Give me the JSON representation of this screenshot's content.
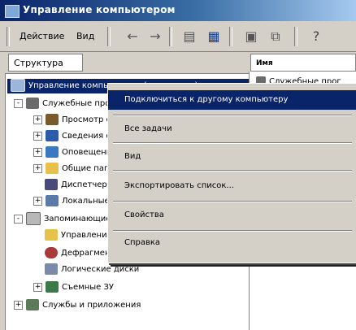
{
  "window": {
    "title": "Управление компьютером"
  },
  "toolbar": {
    "action_label": "Действие",
    "view_label": "Вид",
    "icons": [
      "back-icon",
      "forward-icon",
      "up-icon",
      "console-icon",
      "properties-icon",
      "export-icon",
      "help-icon"
    ]
  },
  "left_panel": {
    "header": "Структура"
  },
  "right_panel": {
    "header": "Имя",
    "first_item": "Служебные прог"
  },
  "tree": {
    "root": "Управление компьютером (локальным)",
    "items": [
      {
        "label": "Служебные программы",
        "level": 1,
        "expand": "-"
      },
      {
        "label": "Просмотр событий",
        "level": 2,
        "expand": "+"
      },
      {
        "label": "Сведения о системе",
        "level": 2,
        "expand": "+"
      },
      {
        "label": "Оповещения и журналы",
        "level": 2,
        "expand": "+"
      },
      {
        "label": "Общие папки",
        "level": 2,
        "expand": "+"
      },
      {
        "label": "Диспетчер устройств",
        "level": 2,
        "expand": ""
      },
      {
        "label": "Локальные пользователи",
        "level": 2,
        "expand": "+"
      },
      {
        "label": "Запоминающие устройства",
        "level": 1,
        "expand": "-"
      },
      {
        "label": "Управление дисками",
        "level": 2,
        "expand": ""
      },
      {
        "label": "Дефрагментация диска",
        "level": 2,
        "expand": ""
      },
      {
        "label": "Логические диски",
        "level": 2,
        "expand": ""
      },
      {
        "label": "Съемные ЗУ",
        "level": 2,
        "expand": "+"
      },
      {
        "label": "Службы и приложения",
        "level": 1,
        "expand": "+"
      }
    ]
  },
  "context_menu": {
    "items": [
      {
        "label": "Подключиться к другому компьютеру",
        "highlighted": true
      },
      {
        "label": "Все задачи"
      },
      {
        "label": "Вид"
      },
      {
        "label": "Экспортировать список..."
      },
      {
        "label": "Свойства"
      },
      {
        "label": "Справка"
      }
    ]
  },
  "colors": {
    "selection": "#0a246a",
    "face": "#d4d0c8"
  }
}
